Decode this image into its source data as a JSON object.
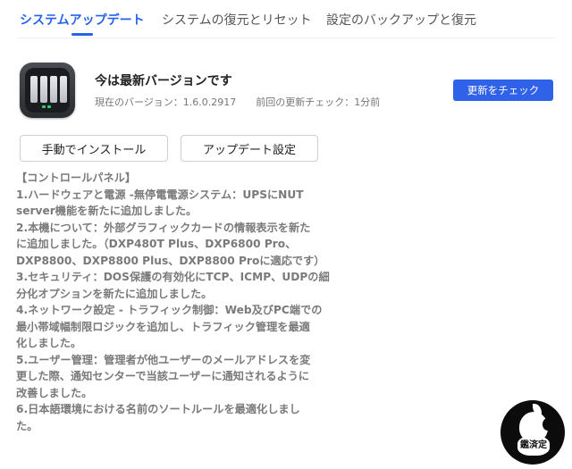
{
  "tabs": [
    {
      "label": "システムアップデート",
      "active": true
    },
    {
      "label": "システムの復元とリセット",
      "active": false
    },
    {
      "label": "設定のバックアップと復元",
      "active": false
    }
  ],
  "status": {
    "title": "今は最新バージョンです",
    "current_version": "現在のバージョン：1.6.0.2917",
    "last_check": "前回の更新チェック：1分前"
  },
  "buttons": {
    "check_update": "更新をチェック",
    "manual_install": "手動でインストール",
    "update_settings": "アップデート設定"
  },
  "release_notes": [
    "【コントロールパネル】",
    "1.ハードウェアと電源 -無停電電源システム：UPSにNUT",
    "server機能を新たに追加しました。",
    "2.本機について：外部グラフィックカードの情報表示を新た",
    "に追加しました。（DXP480T Plus、DXP6800 Pro、",
    "DXP8800、DXP8800 Plus、DXP8800 Proに適応です）",
    "3.セキュリティ：DOS保護の有効化にTCP、ICMP、UDPの細",
    "分化オプションを新たに追加しました。",
    "4.ネットワーク設定 - トラフィック制御：Web及びPC端での",
    "最小帯域幅制限ロジックを追加し、トラフィック管理を最適",
    "化しました。",
    "5.ユーザー管理：管理者が他ユーザーのメールアドレスを変",
    "更した際、通知センターで当該ユーザーに通知されるように",
    "改善しました。",
    "6.日本語環境における名前のソートルールを最適化しまし",
    "た。"
  ],
  "badge": {
    "text": "鑑済定"
  },
  "colors": {
    "accent": "#2563eb",
    "button_blue": "#2f62e8",
    "notes_text": "#7a7a7a"
  },
  "icons": {
    "app": "nas-device-icon",
    "badge": "apple-logo-icon"
  }
}
